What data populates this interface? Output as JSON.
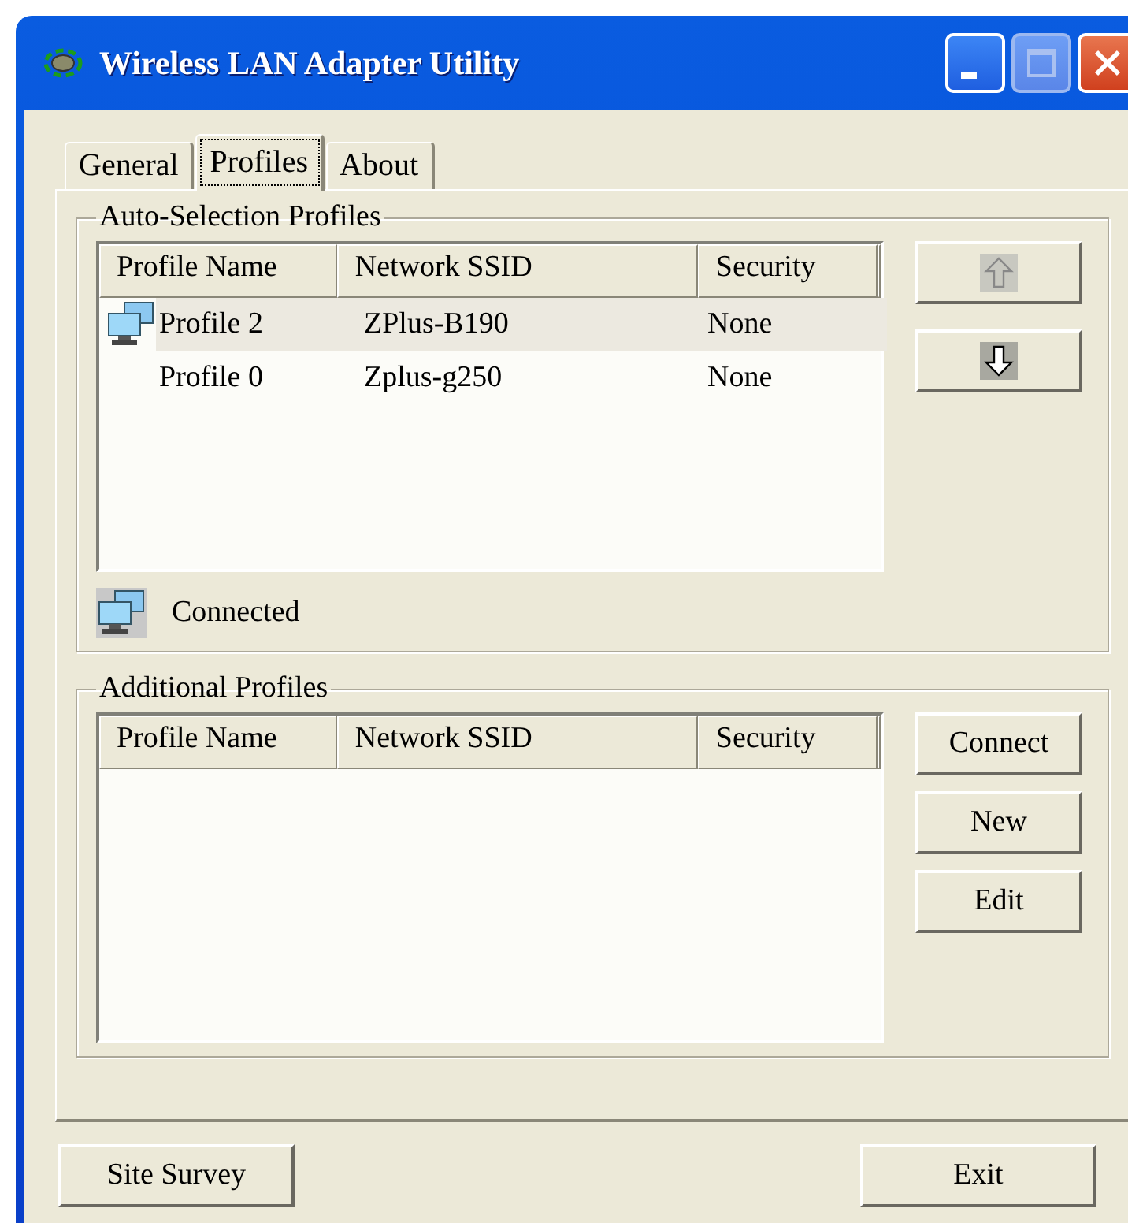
{
  "window": {
    "title": "Wireless LAN Adapter Utility"
  },
  "tabs": [
    {
      "label": "General",
      "selected": false
    },
    {
      "label": "Profiles",
      "selected": true
    },
    {
      "label": "About",
      "selected": false
    }
  ],
  "auto_selection": {
    "title": "Auto-Selection Profiles",
    "columns": [
      "Profile Name",
      "Network SSID",
      "Security"
    ],
    "rows": [
      {
        "profile_name": "Profile 2",
        "network_ssid": "ZPlus-B190",
        "security": "None",
        "selected": true,
        "connected": true
      },
      {
        "profile_name": "Profile 0",
        "network_ssid": "Zplus-g250",
        "security": "None",
        "selected": false,
        "connected": false
      }
    ],
    "move_up": {
      "disabled": true
    },
    "move_down": {
      "disabled": false
    },
    "status": "Connected"
  },
  "additional": {
    "title": "Additional Profiles",
    "columns": [
      "Profile Name",
      "Network SSID",
      "Security"
    ],
    "buttons": [
      "Connect",
      "New",
      "Edit"
    ]
  },
  "footer_buttons": [
    "Site Survey",
    "Exit"
  ]
}
